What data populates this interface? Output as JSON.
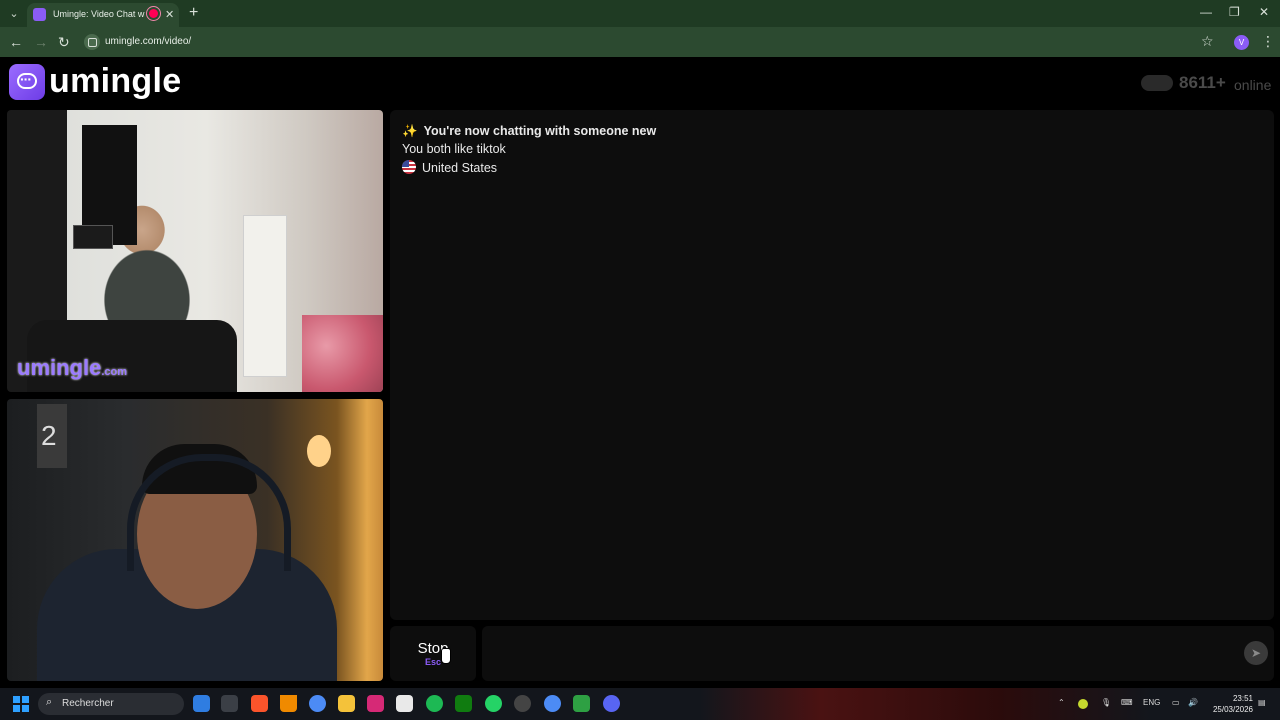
{
  "browser": {
    "tab_title": "Umingle: Video Chat with S",
    "url": "umingle.com/video/",
    "profile_initial": "V"
  },
  "site": {
    "logo_text": "umingle",
    "online_count": "8611+",
    "online_label": "online"
  },
  "video": {
    "watermark_main": "umingle",
    "watermark_suffix": ".com"
  },
  "chat": {
    "messages": [
      {
        "icon": "sparkles",
        "text": "You're now chatting with someone new"
      },
      {
        "text": "You both like tiktok"
      },
      {
        "icon": "us-flag",
        "text": "United States"
      }
    ]
  },
  "controls": {
    "stop_label": "Stop",
    "stop_key": "Esc",
    "message_placeholder": ""
  },
  "taskbar": {
    "search_placeholder": "Rechercher",
    "language": "ENG",
    "time": "23:51",
    "date": "25/03/2026",
    "apps": [
      "brave",
      "vlc",
      "chrome",
      "files",
      "instagram",
      "store",
      "spotify",
      "xbox",
      "whatsapp",
      "steam",
      "chrome-profile",
      "media",
      "discord"
    ]
  },
  "colors": {
    "accent": "#8b5cf6",
    "browser_chrome": "#1f3b23",
    "page_bg": "#000000",
    "panel_bg": "#0d0d0d"
  }
}
